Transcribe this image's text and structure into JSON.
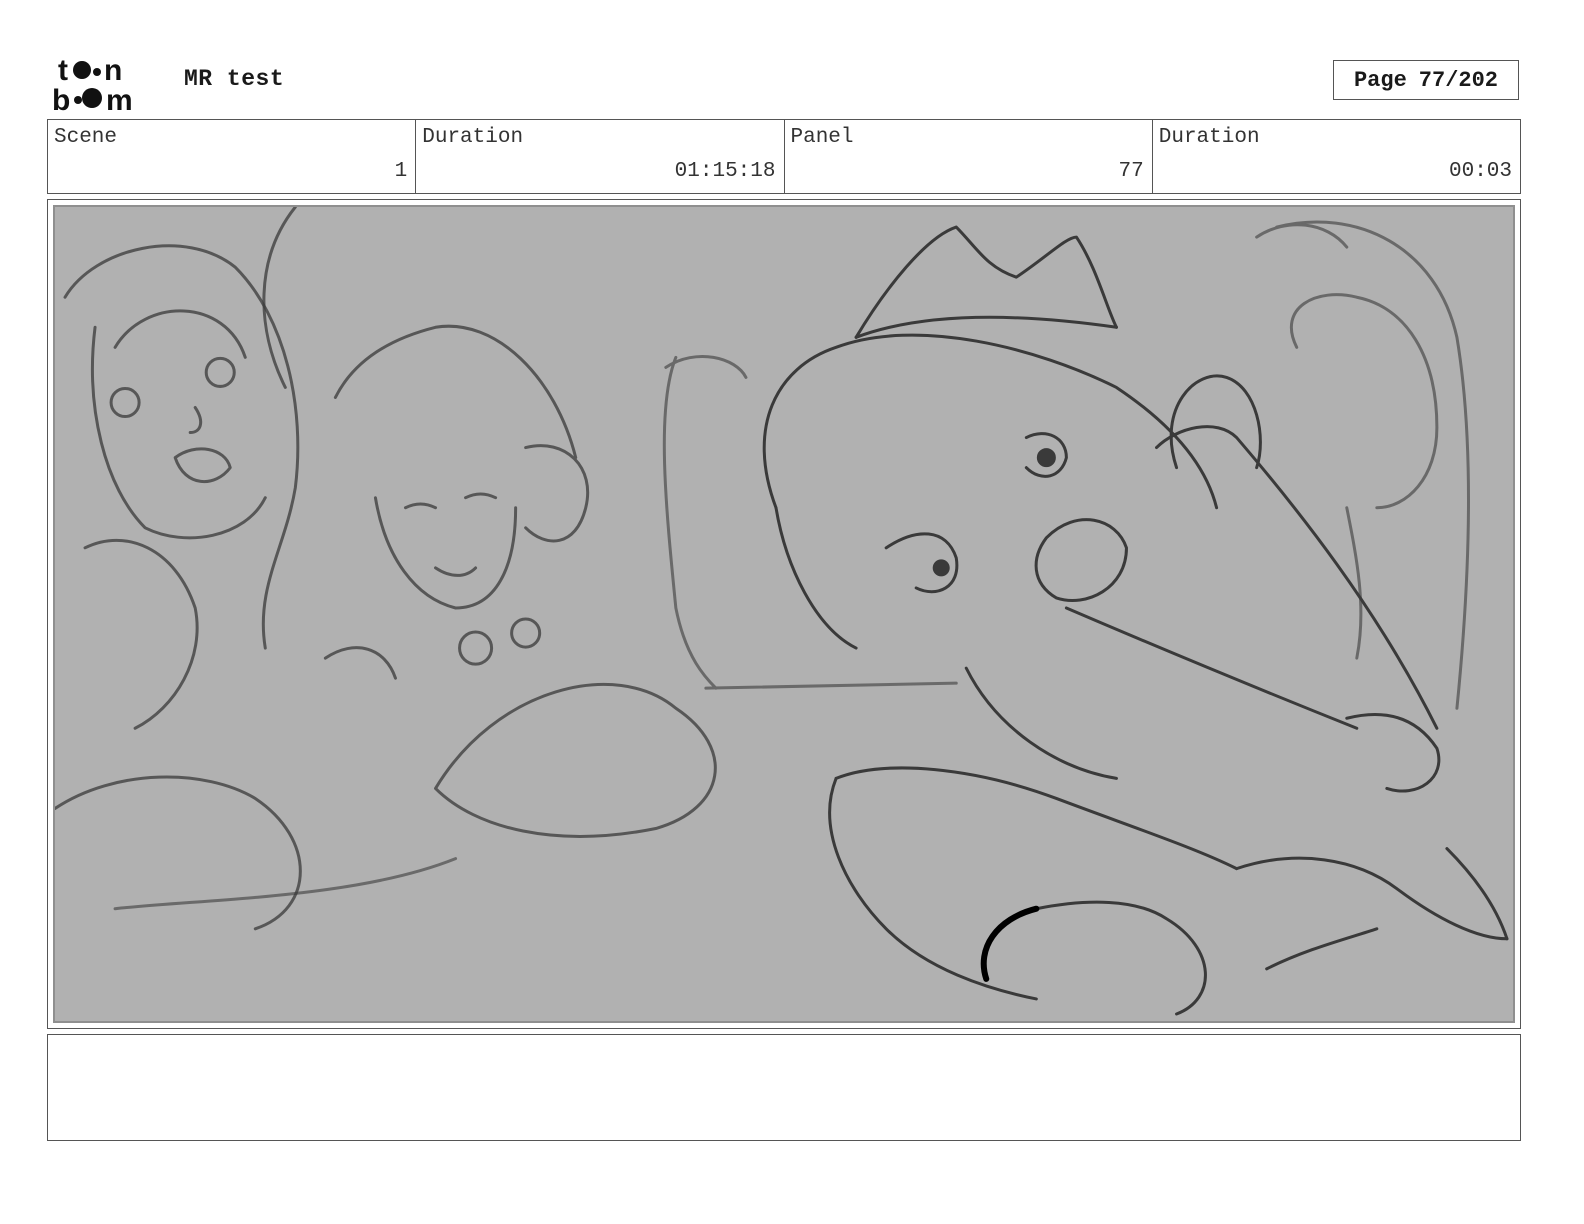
{
  "header": {
    "logo_text": "toon boom",
    "doc_title": "MR test",
    "page_label": "Page",
    "page_value": "77/202"
  },
  "info": {
    "scene_label": "Scene",
    "scene_value": "1",
    "scene_duration_label": "Duration",
    "scene_duration_value": "01:15:18",
    "panel_label": "Panel",
    "panel_value": "77",
    "panel_duration_label": "Duration",
    "panel_duration_value": "00:03"
  },
  "notes": {
    "text": ""
  }
}
